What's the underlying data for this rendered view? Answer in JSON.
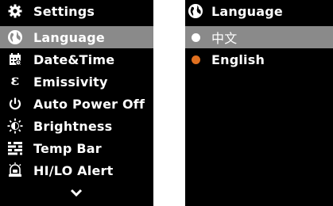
{
  "settings_screen": {
    "title": "Settings",
    "items": [
      {
        "label": "Language",
        "icon": "globe-icon",
        "selected": true
      },
      {
        "label": "Date&Time",
        "icon": "calendar-icon",
        "selected": false
      },
      {
        "label": "Emissivity",
        "icon": "emissivity-icon",
        "selected": false
      },
      {
        "label": "Auto Power Off",
        "icon": "power-icon",
        "selected": false
      },
      {
        "label": "Brightness",
        "icon": "brightness-icon",
        "selected": false
      },
      {
        "label": "Temp Bar",
        "icon": "temp-bar-icon",
        "selected": false
      },
      {
        "label": "HI/LO Alert",
        "icon": "alarm-bell-icon",
        "selected": false
      }
    ],
    "more_indicator": "chevron-down-icon"
  },
  "language_screen": {
    "title": "Language",
    "options": [
      {
        "label": "中文",
        "selected": true,
        "dot_color": "#ffffff"
      },
      {
        "label": "English",
        "selected": false,
        "dot_color": "#e07020"
      }
    ]
  },
  "colors": {
    "background": "#000000",
    "text": "#ffffff",
    "highlight": "#8a8a8a",
    "accent_dot": "#e07020"
  }
}
